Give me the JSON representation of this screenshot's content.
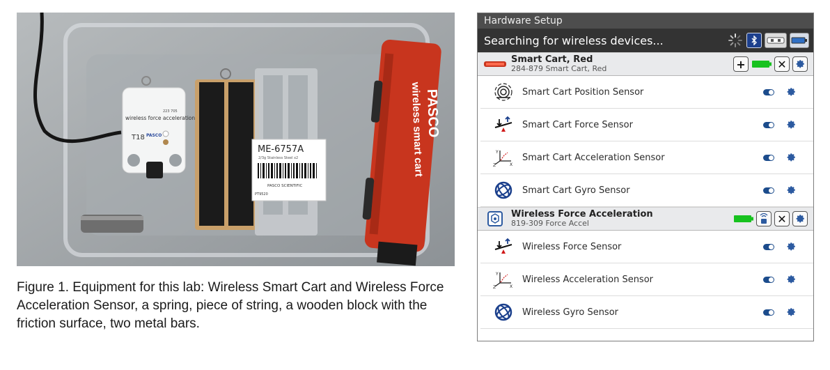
{
  "photo": {
    "cart_brand": "PASCO",
    "cart_text": "wireless smart cart",
    "sensor_title": "wireless force acceleration",
    "sensor_id": "T18",
    "sensor_brand": "PASCO",
    "sensor_serial": "223 705",
    "bag_model": "ME-6757A",
    "bag_sub": "2/3g Stainless Steel x2",
    "bag_brand": "PASCO SCIENTIFIC",
    "bag_code": "PT9520"
  },
  "caption": "Figure 1. Equipment for this lab: Wireless Smart Cart and Wireless Force Acceleration Sensor, a spring, piece of string, a wooden block with the friction surface, two metal bars.",
  "panel": {
    "title": "Hardware Setup",
    "search_text": "Searching for wireless devices...",
    "icons": [
      "spinner-icon",
      "bluetooth-icon",
      "usb-icon",
      "battery-icon"
    ]
  },
  "devices": [
    {
      "name": "Smart Cart, Red",
      "sub": "284-879 Smart Cart, Red",
      "sensors": [
        {
          "label": "Smart Cart Position Sensor",
          "icon": "position-sensor-icon"
        },
        {
          "label": "Smart Cart Force Sensor",
          "icon": "force-sensor-icon"
        },
        {
          "label": "Smart Cart Acceleration Sensor",
          "icon": "acceleration-sensor-icon"
        },
        {
          "label": "Smart Cart Gyro Sensor",
          "icon": "gyro-sensor-icon"
        }
      ]
    },
    {
      "name": "Wireless Force Acceleration",
      "sub": "819-309 Force Accel",
      "sensors": [
        {
          "label": "Wireless Force Sensor",
          "icon": "force-sensor-icon"
        },
        {
          "label": "Wireless Acceleration Sensor",
          "icon": "acceleration-sensor-icon"
        },
        {
          "label": "Wireless Gyro Sensor",
          "icon": "gyro-sensor-icon"
        }
      ]
    }
  ],
  "colors": {
    "panel_title_bg": "#4d4d4d",
    "search_bg": "#333333",
    "toggle_blue": "#1c4c8c",
    "battery_green": "#17c21f",
    "cart_red": "#c8351e"
  }
}
